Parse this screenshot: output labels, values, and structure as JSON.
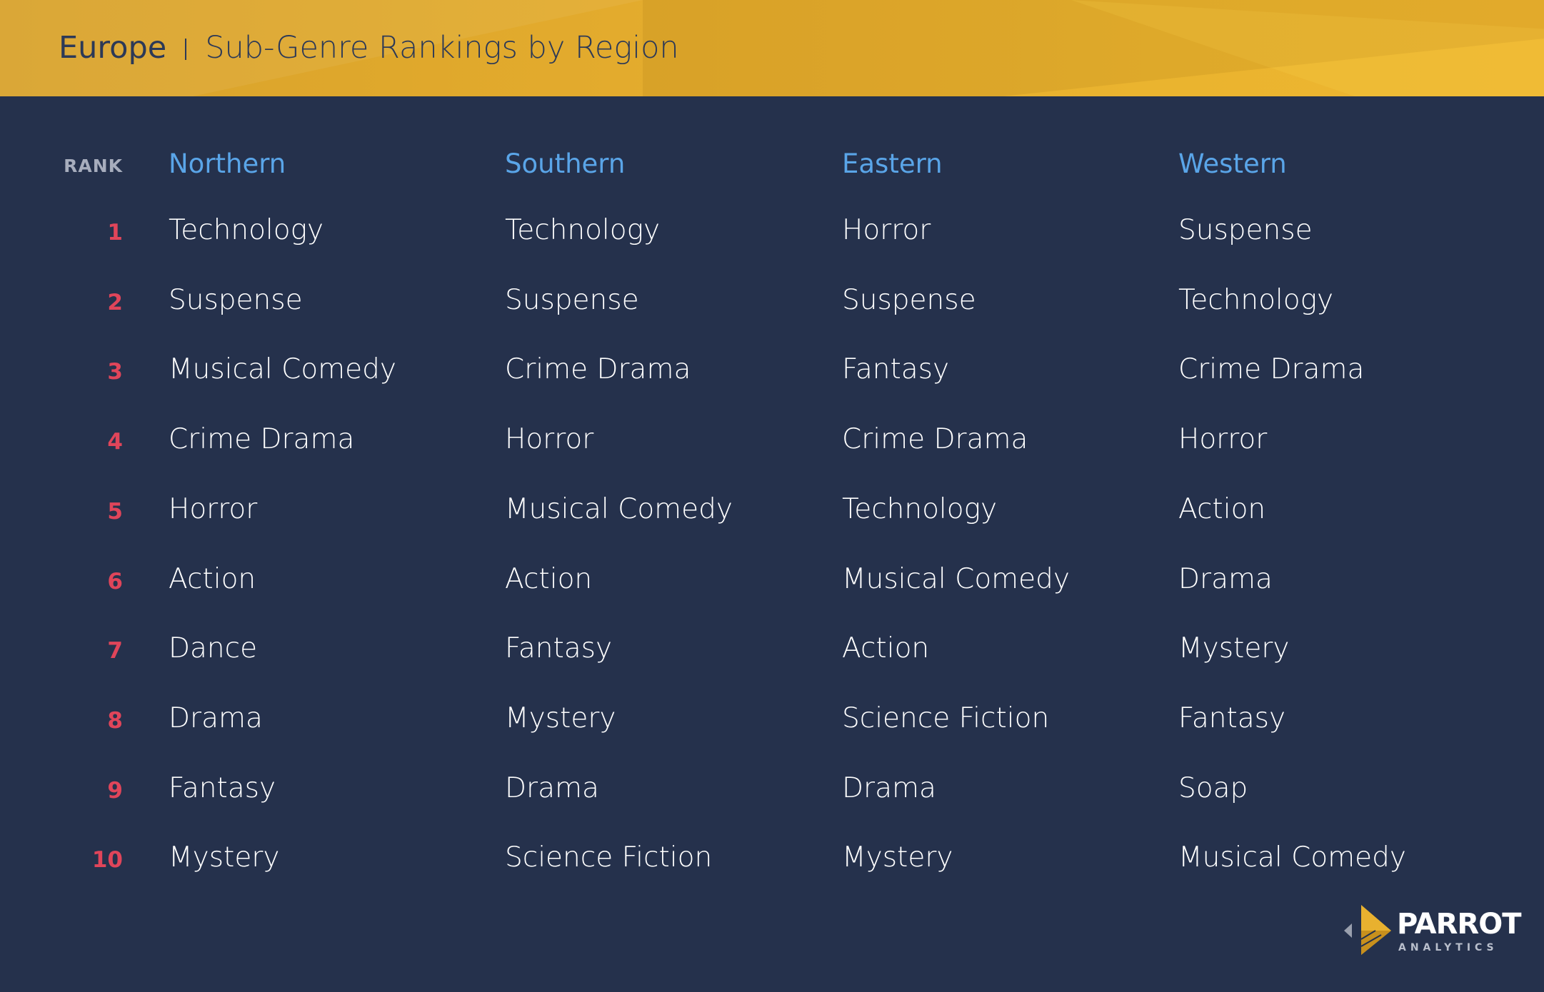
{
  "header": {
    "region": "Europe",
    "subtitle": "Sub-Genre Rankings by Region"
  },
  "table": {
    "rank_label": "RANK",
    "columns": [
      "Northern",
      "Southern",
      "Eastern",
      "Western"
    ],
    "ranks": [
      "1",
      "2",
      "3",
      "4",
      "5",
      "6",
      "7",
      "8",
      "9",
      "10"
    ],
    "rows": [
      [
        "Technology",
        "Technology",
        "Horror",
        "Suspense"
      ],
      [
        "Suspense",
        "Suspense",
        "Suspense",
        "Technology"
      ],
      [
        "Musical Comedy",
        "Crime Drama",
        "Fantasy",
        "Crime Drama"
      ],
      [
        "Crime Drama",
        "Horror",
        "Crime Drama",
        "Horror"
      ],
      [
        "Horror",
        "Musical Comedy",
        "Technology",
        "Action"
      ],
      [
        "Action",
        "Action",
        "Musical Comedy",
        "Drama"
      ],
      [
        "Dance",
        "Fantasy",
        "Action",
        "Mystery"
      ],
      [
        "Drama",
        "Mystery",
        "Science Fiction",
        "Fantasy"
      ],
      [
        "Fantasy",
        "Drama",
        "Drama",
        "Soap"
      ],
      [
        "Mystery",
        "Science Fiction",
        "Mystery",
        "Musical Comedy"
      ]
    ]
  },
  "logo": {
    "name": "PARROT",
    "tagline": "ANALYTICS"
  },
  "colors": {
    "background": "#25314c",
    "header": "#e8b12f",
    "column_heading": "#5aa5e8",
    "rank_number": "#e0455a"
  }
}
